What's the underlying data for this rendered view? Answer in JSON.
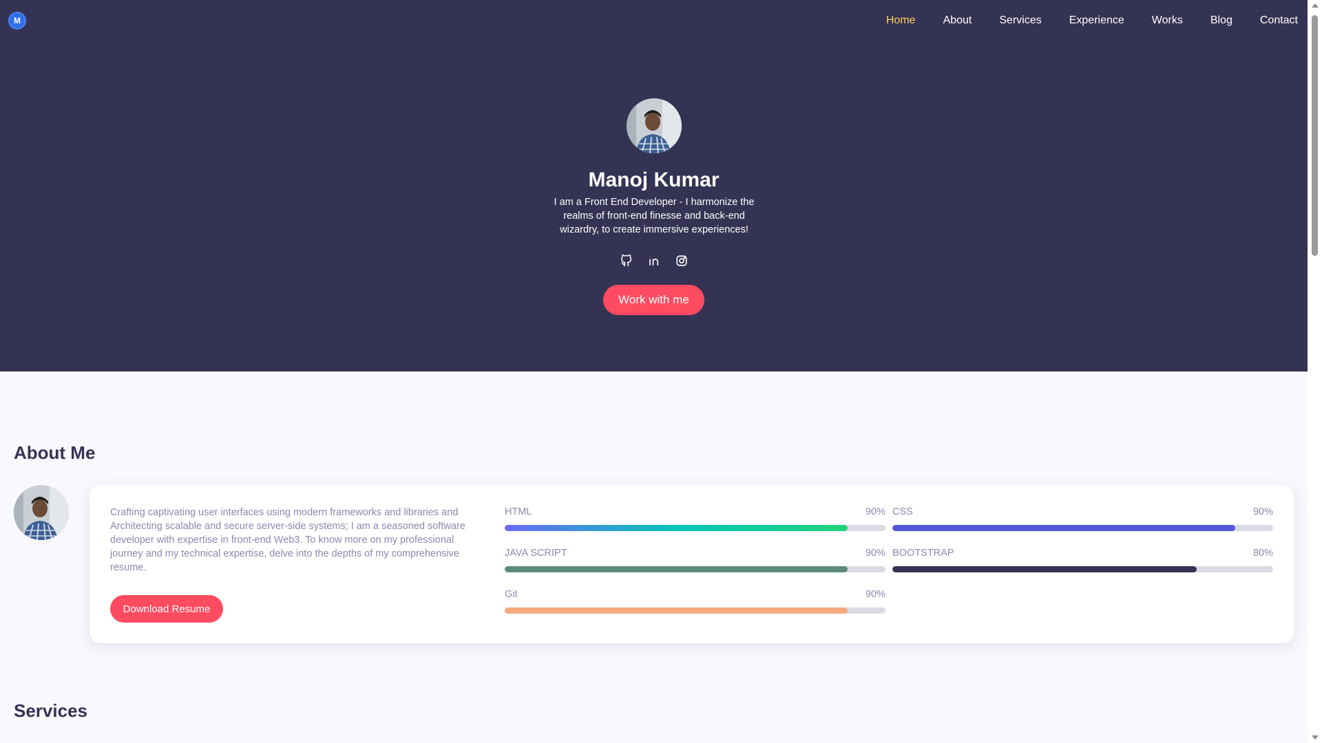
{
  "nav": {
    "logo_letter": "M",
    "items": [
      {
        "label": "Home",
        "active": true
      },
      {
        "label": "About",
        "active": false
      },
      {
        "label": "Services",
        "active": false
      },
      {
        "label": "Experience",
        "active": false
      },
      {
        "label": "Works",
        "active": false
      },
      {
        "label": "Blog",
        "active": false
      },
      {
        "label": "Contact",
        "active": false
      }
    ]
  },
  "hero": {
    "name": "Manoj Kumar",
    "description": "I am a Front End Developer - I harmonize the realms of front-end finesse and back-end wizardry, to create immersive experiences!",
    "socials": [
      "github-icon",
      "linkedin-icon",
      "instagram-icon"
    ],
    "cta_label": "Work with me"
  },
  "about": {
    "title": "About Me",
    "text": "Crafting captivating user interfaces using modern frameworks and libraries and Architecting scalable and secure server-side systems; I am a seasoned software developer with expertise in front-end Web3. To know more on my professional journey and my technical expertise, delve into the depths of my comprehensive resume.",
    "download_label": "Download Resume",
    "skills": [
      {
        "name": "HTML",
        "percent": "90%",
        "value": 0.9,
        "colors": [
          "#6c6af6",
          "#05c4b8",
          "#22d37a"
        ]
      },
      {
        "name": "CSS",
        "percent": "90%",
        "value": 0.9,
        "colors": [
          "#5654d9",
          "#5654d9"
        ]
      },
      {
        "name": "JAVA SCRIPT",
        "percent": "90%",
        "value": 0.9,
        "colors": [
          "#5d8c7c",
          "#5d8c7c"
        ]
      },
      {
        "name": "BOOTSTRAP",
        "percent": "80%",
        "value": 0.8,
        "colors": [
          "#353353",
          "#353353"
        ]
      },
      {
        "name": "Git",
        "percent": "90%",
        "value": 0.9,
        "colors": [
          "#f4a97e",
          "#f4a97e"
        ]
      }
    ]
  },
  "services": {
    "title": "Services"
  },
  "colors": {
    "primary_dark": "#353353",
    "accent": "#ff4c60",
    "nav_active": "#ffd15c",
    "background": "#f9f8fd"
  }
}
